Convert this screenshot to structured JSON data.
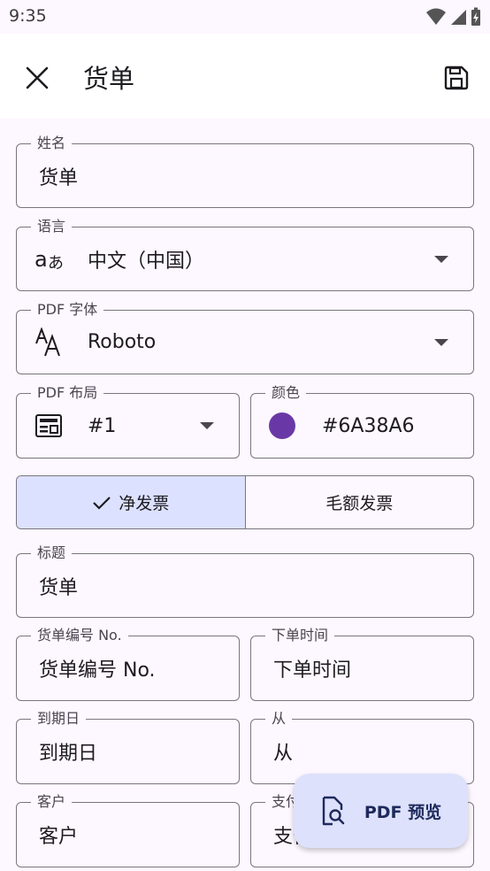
{
  "status_bar": {
    "time": "9:35"
  },
  "app_bar": {
    "title": "货单"
  },
  "fields": {
    "name": {
      "label": "姓名",
      "value": "货单"
    },
    "language": {
      "label": "语言",
      "value": "中文（中国）"
    },
    "pdf_font": {
      "label": "PDF 字体",
      "value": "Roboto"
    },
    "pdf_layout": {
      "label": "PDF 布局",
      "value": "#1"
    },
    "color": {
      "label": "颜色",
      "value": "#6A38A6",
      "swatch": "#6A38A6"
    },
    "title": {
      "label": "标题",
      "value": "货单"
    },
    "invoice_number": {
      "label": "货单编号 No.",
      "value": "货单编号 No."
    },
    "order_time": {
      "label": "下单时间",
      "value": "下单时间"
    },
    "due_date": {
      "label": "到期日",
      "value": "到期日"
    },
    "from": {
      "label": "从",
      "value": "从"
    },
    "customer": {
      "label": "客户",
      "value": "客户"
    },
    "payment": {
      "label": "支付",
      "value": "支付"
    }
  },
  "segmented": {
    "net_invoice": "净发票",
    "gross_invoice": "毛额发票",
    "selected": "net_invoice"
  },
  "fab": {
    "label": "PDF 预览"
  },
  "colors": {
    "accent_container": "#dce1ff",
    "outline": "#7a757f",
    "background": "#fdf7ff"
  }
}
